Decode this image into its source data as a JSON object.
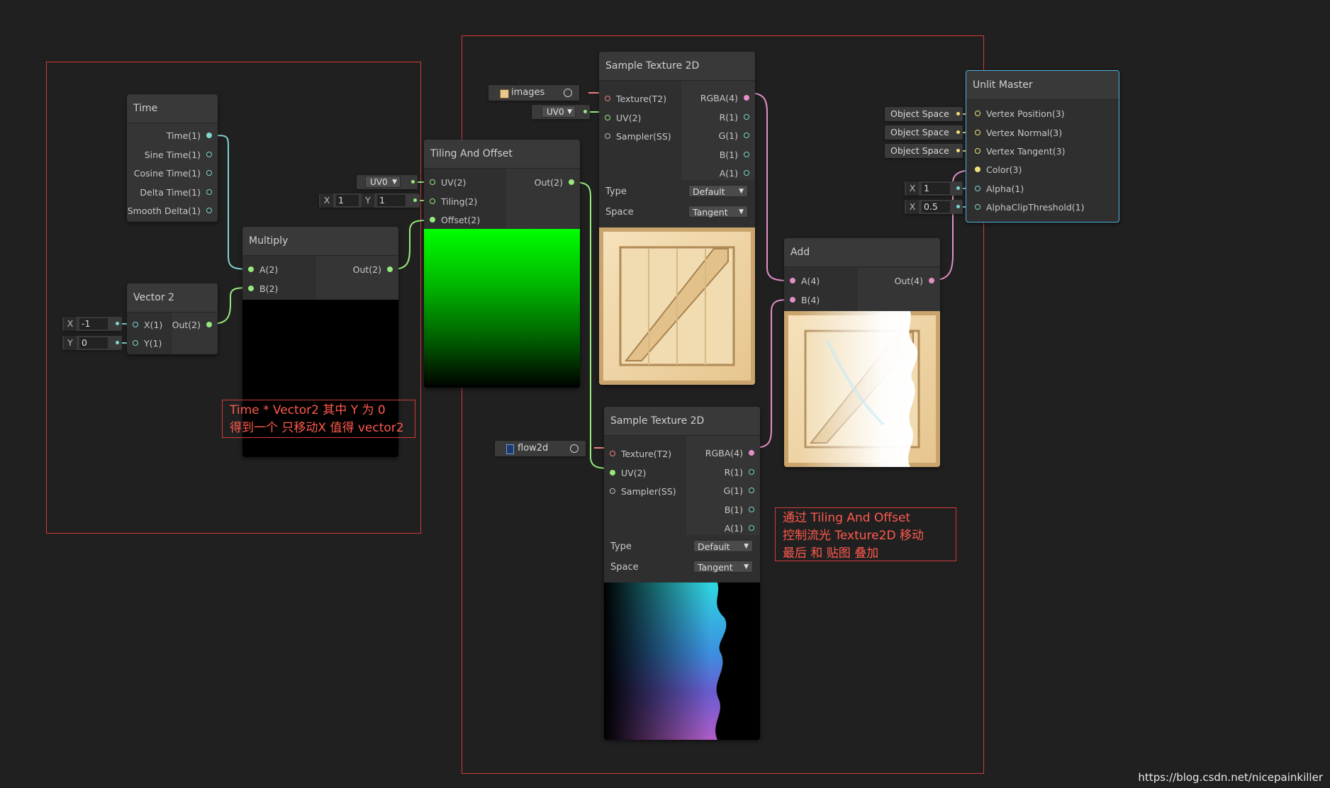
{
  "nodes": {
    "time": {
      "title": "Time",
      "outputs": [
        "Time(1)",
        "Sine Time(1)",
        "Cosine Time(1)",
        "Delta Time(1)",
        "Smooth Delta(1)"
      ]
    },
    "vector2": {
      "title": "Vector 2",
      "inputs": [
        "X(1)",
        "Y(1)"
      ],
      "output": "Out(2)",
      "fields": [
        {
          "axis": "X",
          "value": "-1"
        },
        {
          "axis": "Y",
          "value": "0"
        }
      ]
    },
    "multiply": {
      "title": "Multiply",
      "inputs": [
        "A(2)",
        "B(2)"
      ],
      "output": "Out(2)"
    },
    "tiling": {
      "title": "Tiling And Offset",
      "inputs": [
        "UV(2)",
        "Tiling(2)",
        "Offset(2)"
      ],
      "output": "Out(2)",
      "uv_option": "UV0",
      "tiling_fields": [
        {
          "axis": "X",
          "value": "1"
        },
        {
          "axis": "Y",
          "value": "1"
        }
      ]
    },
    "sample1": {
      "title": "Sample Texture 2D",
      "inputs": [
        "Texture(T2)",
        "UV(2)",
        "Sampler(SS)"
      ],
      "outputs": [
        "RGBA(4)",
        "R(1)",
        "G(1)",
        "B(1)",
        "A(1)"
      ],
      "type_label": "Type",
      "type_value": "Default",
      "space_label": "Space",
      "space_value": "Tangent",
      "texture_name": "images",
      "uv_option": "UV0"
    },
    "sample2": {
      "title": "Sample Texture 2D",
      "inputs": [
        "Texture(T2)",
        "UV(2)",
        "Sampler(SS)"
      ],
      "outputs": [
        "RGBA(4)",
        "R(1)",
        "G(1)",
        "B(1)",
        "A(1)"
      ],
      "type_label": "Type",
      "type_value": "Default",
      "space_label": "Space",
      "space_value": "Tangent",
      "texture_name": "flow2d"
    },
    "add": {
      "title": "Add",
      "inputs": [
        "A(4)",
        "B(4)"
      ],
      "output": "Out(4)"
    },
    "unlit": {
      "title": "Unlit Master",
      "inputs": [
        "Vertex Position(3)",
        "Vertex Normal(3)",
        "Vertex Tangent(3)",
        "Color(3)",
        "Alpha(1)",
        "AlphaClipThreshold(1)"
      ],
      "space_fields": [
        "Object Space",
        "Object Space",
        "Object Space"
      ],
      "alpha_field": {
        "axis": "X",
        "value": "1"
      },
      "clip_field": {
        "axis": "X",
        "value": "0.5"
      }
    }
  },
  "annotations": {
    "left": [
      "Time *  Vector2 其中 Y 为 0",
      "得到一个 只移动X 值得 vector2"
    ],
    "right": [
      "通过 Tiling And Offset",
      "控制流光 Texture2D  移动",
      "最后 和 贴图 叠加"
    ]
  },
  "colors": {
    "background": "#202020",
    "group_border": "#d23a3a",
    "annotation_text": "#ff5a4d",
    "wire_float": "#7fd6cf",
    "wire_vec2": "#97e97c",
    "wire_vec4": "#e38fc7",
    "wire_vec3": "#f0e07c",
    "master_border": "#4fb3e0"
  },
  "watermark": "https://blog.csdn.net/nicepainkiller"
}
